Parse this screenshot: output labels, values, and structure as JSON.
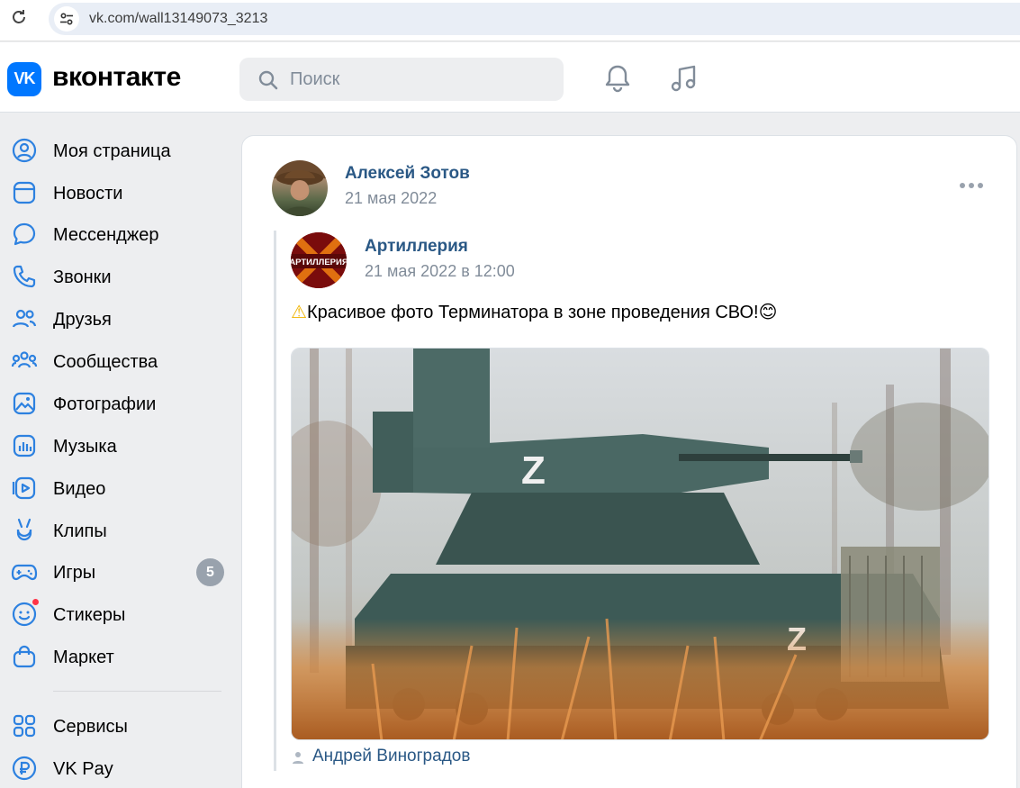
{
  "browser": {
    "url": "vk.com/wall13149073_3213"
  },
  "header": {
    "logo_text": "VK",
    "brand_name": "вконтакте",
    "search_placeholder": "Поиск"
  },
  "sidebar": {
    "items": [
      {
        "label": "Моя страница",
        "icon": "user-circle-icon"
      },
      {
        "label": "Новости",
        "icon": "news-icon"
      },
      {
        "label": "Мессенджер",
        "icon": "chat-icon"
      },
      {
        "label": "Звонки",
        "icon": "phone-icon"
      },
      {
        "label": "Друзья",
        "icon": "friends-icon"
      },
      {
        "label": "Сообщества",
        "icon": "communities-icon"
      },
      {
        "label": "Фотографии",
        "icon": "photo-icon"
      },
      {
        "label": "Музыка",
        "icon": "music-icon"
      },
      {
        "label": "Видео",
        "icon": "video-icon"
      },
      {
        "label": "Клипы",
        "icon": "clips-icon"
      },
      {
        "label": "Игры",
        "icon": "gamepad-icon",
        "badge": "5"
      },
      {
        "label": "Стикеры",
        "icon": "sticker-icon"
      },
      {
        "label": "Маркет",
        "icon": "market-bag-icon"
      },
      {
        "label": "Сервисы",
        "icon": "services-grid-icon"
      },
      {
        "label": "VK Pay",
        "icon": "vkpay-icon"
      }
    ]
  },
  "post": {
    "author": "Алексей Зотов",
    "date": "21 мая 2022",
    "repost": {
      "group": "Артиллерия",
      "group_avatar_text": "АРТИЛЛЕРИЯ",
      "date": "21 мая 2022 в 12:00",
      "text_warning": "⚠",
      "text": "Красивое фото Терминатора в зоне проведения СВО!",
      "text_emoji": "😊",
      "photo_marks": [
        "Z",
        "Z"
      ],
      "photo_credit": "Андрей Виноградов"
    }
  },
  "colors": {
    "accent": "#0077ff",
    "link": "#2a5885",
    "muted": "#818c99",
    "badge": "#99a2ad"
  }
}
